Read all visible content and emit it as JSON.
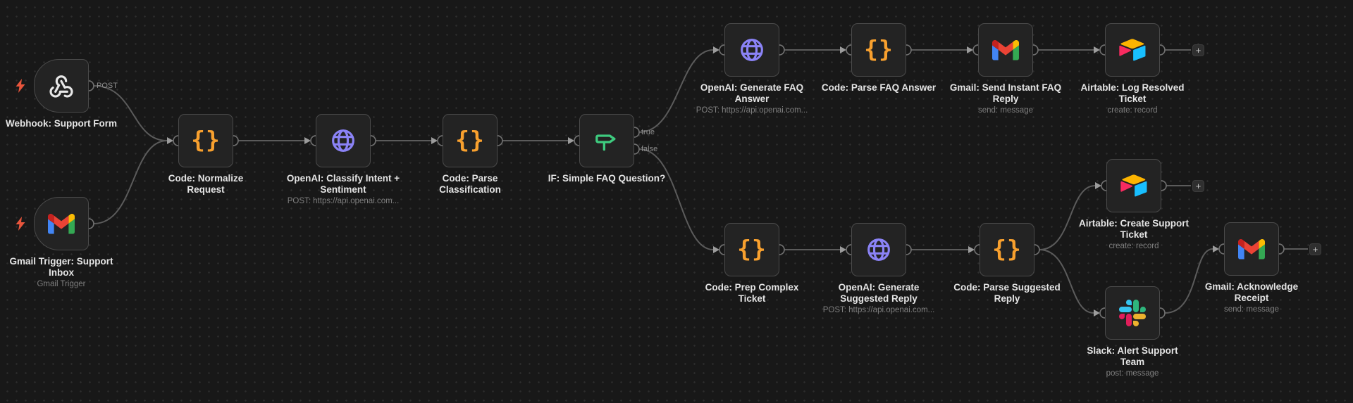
{
  "workflow": {
    "nodes": {
      "webhook": {
        "label": "Webhook: Support Form",
        "icon": "webhook-icon"
      },
      "gmail_trigger": {
        "label": "Gmail Trigger: Support\nInbox",
        "subtitle": "Gmail Trigger",
        "icon": "gmail-icon"
      },
      "code_normalize": {
        "label": "Code: Normalize\nRequest",
        "icon": "code-braces-icon"
      },
      "openai_classify": {
        "label": "OpenAI: Classify Intent +\nSentiment",
        "subtitle": "POST: https://api.openai.com...",
        "icon": "globe-icon"
      },
      "code_parse_classification": {
        "label": "Code: Parse\nClassification",
        "icon": "code-braces-icon"
      },
      "if_faq": {
        "label": "IF: Simple FAQ Question?",
        "icon": "signpost-icon"
      },
      "openai_faq": {
        "label": "OpenAI: Generate FAQ\nAnswer",
        "subtitle": "POST: https://api.openai.com...",
        "icon": "globe-icon"
      },
      "code_parse_faq": {
        "label": "Code: Parse FAQ Answer",
        "icon": "code-braces-icon"
      },
      "gmail_send_faq": {
        "label": "Gmail: Send Instant FAQ\nReply",
        "subtitle": "send: message",
        "icon": "gmail-icon"
      },
      "airtable_log": {
        "label": "Airtable: Log Resolved\nTicket",
        "subtitle": "create: record",
        "icon": "airtable-icon"
      },
      "code_prep": {
        "label": "Code: Prep Complex\nTicket",
        "icon": "code-braces-icon"
      },
      "openai_suggest": {
        "label": "OpenAI: Generate\nSuggested Reply",
        "subtitle": "POST: https://api.openai.com...",
        "icon": "globe-icon"
      },
      "code_parse_suggested": {
        "label": "Code: Parse Suggested\nReply",
        "icon": "code-braces-icon"
      },
      "airtable_create": {
        "label": "Airtable: Create Support\nTicket",
        "subtitle": "create: record",
        "icon": "airtable-icon"
      },
      "slack_alert": {
        "label": "Slack: Alert Support\nTeam",
        "subtitle": "post: message",
        "icon": "slack-icon"
      },
      "gmail_ack": {
        "label": "Gmail: Acknowledge\nReceipt",
        "subtitle": "send: message",
        "icon": "gmail-icon"
      }
    },
    "connector_labels": {
      "post": "POST",
      "if_true": "true",
      "if_false": "false"
    },
    "add_button_glyph": "+",
    "icon_glyphs": {
      "code_braces": "{}"
    },
    "colors": {
      "canvas_bg": "#181818",
      "node_bg": "#232323",
      "node_border": "#4a4a4a",
      "wire": "#5b5b5b",
      "code_orange": "#f8a02e",
      "openai_purple": "#8b83f6",
      "if_green": "#3ecb7f",
      "trigger_bolt": "#e8553c",
      "webhook_white": "#e8e8e8",
      "gmail_red": "#ea4335",
      "gmail_blue": "#4285f4",
      "gmail_green": "#34a853",
      "gmail_yellow": "#fbbc04",
      "airtable_yellow": "#fcb400",
      "airtable_blue": "#18bfff",
      "airtable_red": "#f82b60",
      "slack_blue": "#36c5f0",
      "slack_green": "#2eb67d",
      "slack_red": "#e01e5a",
      "slack_yellow": "#ecb22e"
    }
  }
}
